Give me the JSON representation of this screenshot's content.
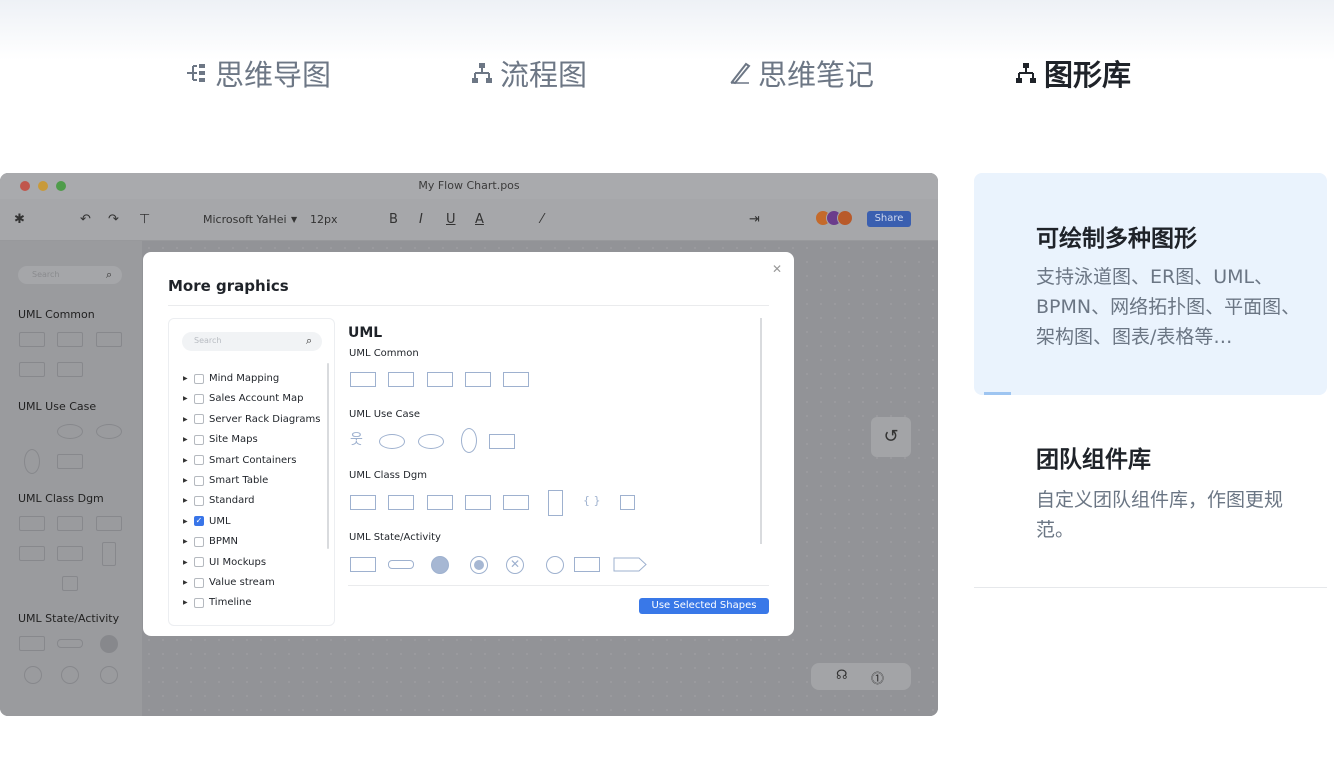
{
  "tabs": [
    {
      "label": "思维导图",
      "icon": "mindmap-icon"
    },
    {
      "label": "流程图",
      "icon": "flowchart-icon"
    },
    {
      "label": "思维笔记",
      "icon": "pen-icon"
    },
    {
      "label": "图形库",
      "icon": "flowchart-icon",
      "active": true
    }
  ],
  "window": {
    "title": "My Flow Chart.pos",
    "font_name": "Microsoft  YaHei",
    "font_size": "12px",
    "share_label": "Share",
    "sidebar_search": "Search",
    "sidebar_sections": [
      "UML Common",
      "UML Use Case",
      "UML Class Dgm",
      "UML State/Activity"
    ]
  },
  "modal": {
    "title": "More graphics",
    "search_placeholder": "Search",
    "library_items": [
      {
        "label": "Mind Mapping",
        "checked": false
      },
      {
        "label": "Sales Account Map",
        "checked": false
      },
      {
        "label": "Server Rack Diagrams",
        "checked": false
      },
      {
        "label": "Site Maps",
        "checked": false
      },
      {
        "label": "Smart Containers",
        "checked": false
      },
      {
        "label": "Smart Table",
        "checked": false
      },
      {
        "label": "Standard",
        "checked": false
      },
      {
        "label": "UML",
        "checked": true
      },
      {
        "label": "BPMN",
        "checked": false
      },
      {
        "label": "UI Mockups",
        "checked": false
      },
      {
        "label": "Value stream",
        "checked": false
      },
      {
        "label": "Timeline",
        "checked": false
      }
    ],
    "section_heading": "UML",
    "groups": [
      "UML Common",
      "UML Use Case",
      "UML Class Dgm",
      "UML State/Activity"
    ],
    "use_button": "Use Selected Shapes"
  },
  "features": [
    {
      "title": "可绘制多种图形",
      "desc": "支持泳道图、ER图、UML、BPMN、网络拓扑图、平面图、架构图、图表/表格等…"
    },
    {
      "title": "团队组件库",
      "desc": "自定义团队组件库，作图更规范。"
    }
  ],
  "colors": {
    "accent": "#3978e8",
    "card_bg": "#eaf3fd"
  }
}
